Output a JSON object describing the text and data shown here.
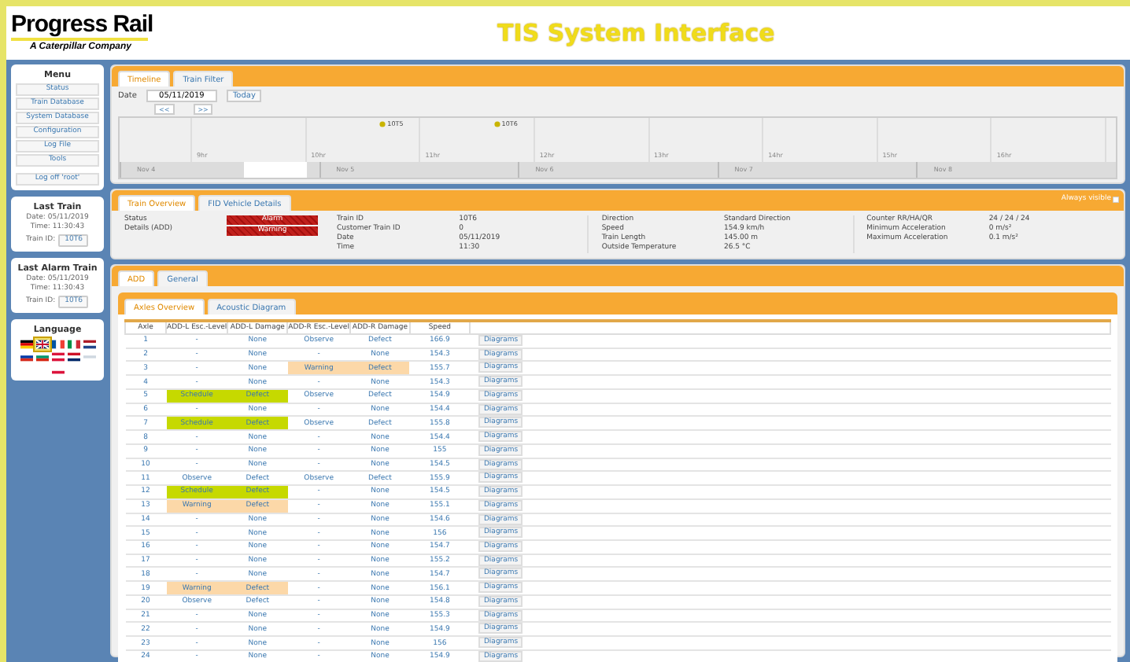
{
  "header": {
    "logo": "Progress Rail",
    "logo_sub": "A Caterpillar Company",
    "title": "TIS System Interface"
  },
  "sidebar": {
    "menu_title": "Menu",
    "menu": [
      "Status",
      "Train Database",
      "System Database",
      "Configuration",
      "Log File",
      "Tools"
    ],
    "logoff": "Log off 'root'",
    "last_train": {
      "title": "Last Train",
      "date": "Date: 05/11/2019",
      "time": "Time: 11:30:43",
      "id_label": "Train ID:",
      "id": "10T6"
    },
    "last_alarm_train": {
      "title": "Last Alarm Train",
      "date": "Date: 05/11/2019",
      "time": "Time: 11:30:43",
      "id_label": "Train ID:",
      "id": "10T6"
    },
    "language_title": "Language",
    "languages": [
      {
        "selected": false
      },
      {
        "selected": true
      },
      {
        "selected": false
      },
      {
        "selected": false
      },
      {
        "selected": false
      },
      {
        "selected": false
      },
      {
        "selected": false
      },
      {
        "selected": false
      },
      {
        "selected": false
      },
      {
        "selected": false
      },
      {
        "selected": false
      }
    ]
  },
  "timeline": {
    "tabs": [
      {
        "label": "Timeline",
        "selected": true
      },
      {
        "label": "Train Filter",
        "selected": false
      }
    ],
    "date_label": "Date",
    "date": "05/11/2019",
    "today": "Today",
    "prev": "<<",
    "next": ">>",
    "hours": [
      {
        "label": "9hr"
      },
      {
        "label": "10hr",
        "event": "10T5"
      },
      {
        "label": "11hr",
        "event": "10T6"
      },
      {
        "label": "12hr"
      },
      {
        "label": "13hr"
      },
      {
        "label": "14hr"
      },
      {
        "label": "15hr"
      },
      {
        "label": "16hr"
      }
    ],
    "days": [
      "Nov 4",
      "Nov 5",
      "Nov 6",
      "Nov 7",
      "Nov 8"
    ]
  },
  "overview": {
    "tabs": [
      {
        "label": "Train Overview",
        "selected": true
      },
      {
        "label": "FID Vehicle Details",
        "selected": false
      }
    ],
    "always_visible": "Always visible",
    "status_label": "Status",
    "status": "Alarm",
    "details_label": "Details (ADD)",
    "details": "Warning",
    "fields": [
      [
        {
          "label": "Train ID",
          "value": "10T6"
        },
        {
          "label": "Customer Train ID",
          "value": "0"
        },
        {
          "label": "Date",
          "value": "05/11/2019"
        },
        {
          "label": "Time",
          "value": "11:30"
        }
      ],
      [
        {
          "label": "Direction",
          "value": "Standard Direction"
        },
        {
          "label": "Speed",
          "value": "154.9 km/h"
        },
        {
          "label": "Train Length",
          "value": "145.00 m"
        },
        {
          "label": "Outside Temperature",
          "value": "26.5 °C"
        }
      ],
      [
        {
          "label": "Counter RR/HA/QR",
          "value": "24 / 24 / 24"
        },
        {
          "label": "Minimum Acceleration",
          "value": "0 m/s²"
        },
        {
          "label": "Maximum Acceleration",
          "value": "0.1 m/s²"
        }
      ]
    ]
  },
  "add": {
    "tabs": [
      {
        "label": "ADD",
        "selected": true
      },
      {
        "label": "General",
        "selected": false
      }
    ],
    "subtabs": [
      {
        "label": "Axles Overview",
        "selected": true
      },
      {
        "label": "Acoustic Diagram",
        "selected": false
      }
    ],
    "columns": [
      "Axle",
      "ADD-L Esc.-Level",
      "ADD-L Damage",
      "ADD-R Esc.-Level",
      "ADD-R Damage",
      "Speed"
    ],
    "rows": [
      {
        "cells": [
          {
            "text": "1"
          },
          {
            "text": "-"
          },
          {
            "text": "None"
          },
          {
            "text": "Observe"
          },
          {
            "text": "Defect"
          },
          {
            "text": "166.9"
          }
        ],
        "button": "Diagrams"
      },
      {
        "cells": [
          {
            "text": "2"
          },
          {
            "text": "-"
          },
          {
            "text": "None"
          },
          {
            "text": "-"
          },
          {
            "text": "None"
          },
          {
            "text": "154.3"
          }
        ],
        "button": "Diagrams"
      },
      {
        "cells": [
          {
            "text": "3"
          },
          {
            "text": "-"
          },
          {
            "text": "None"
          },
          {
            "text": "Warning",
            "color": "#fcd8a8"
          },
          {
            "text": "Defect",
            "color": "#fcd8a8"
          },
          {
            "text": "155.7"
          }
        ],
        "button": "Diagrams"
      },
      {
        "cells": [
          {
            "text": "4"
          },
          {
            "text": "-"
          },
          {
            "text": "None"
          },
          {
            "text": "-"
          },
          {
            "text": "None"
          },
          {
            "text": "154.3"
          }
        ],
        "button": "Diagrams"
      },
      {
        "cells": [
          {
            "text": "5"
          },
          {
            "text": "Schedule",
            "color": "#c6d900"
          },
          {
            "text": "Defect",
            "color": "#c6d900"
          },
          {
            "text": "Observe"
          },
          {
            "text": "Defect"
          },
          {
            "text": "154.9"
          }
        ],
        "button": "Diagrams"
      },
      {
        "cells": [
          {
            "text": "6"
          },
          {
            "text": "-"
          },
          {
            "text": "None"
          },
          {
            "text": "-"
          },
          {
            "text": "None"
          },
          {
            "text": "154.4"
          }
        ],
        "button": "Diagrams"
      },
      {
        "cells": [
          {
            "text": "7"
          },
          {
            "text": "Schedule",
            "color": "#c6d900"
          },
          {
            "text": "Defect",
            "color": "#c6d900"
          },
          {
            "text": "Observe"
          },
          {
            "text": "Defect"
          },
          {
            "text": "155.8"
          }
        ],
        "button": "Diagrams"
      },
      {
        "cells": [
          {
            "text": "8"
          },
          {
            "text": "-"
          },
          {
            "text": "None"
          },
          {
            "text": "-"
          },
          {
            "text": "None"
          },
          {
            "text": "154.4"
          }
        ],
        "button": "Diagrams"
      },
      {
        "cells": [
          {
            "text": "9"
          },
          {
            "text": "-"
          },
          {
            "text": "None"
          },
          {
            "text": "-"
          },
          {
            "text": "None"
          },
          {
            "text": "155"
          }
        ],
        "button": "Diagrams"
      },
      {
        "cells": [
          {
            "text": "10"
          },
          {
            "text": "-"
          },
          {
            "text": "None"
          },
          {
            "text": "-"
          },
          {
            "text": "None"
          },
          {
            "text": "154.5"
          }
        ],
        "button": "Diagrams"
      },
      {
        "cells": [
          {
            "text": "11"
          },
          {
            "text": "Observe"
          },
          {
            "text": "Defect"
          },
          {
            "text": "Observe"
          },
          {
            "text": "Defect"
          },
          {
            "text": "155.9"
          }
        ],
        "button": "Diagrams"
      },
      {
        "cells": [
          {
            "text": "12"
          },
          {
            "text": "Schedule",
            "color": "#c6d900"
          },
          {
            "text": "Defect",
            "color": "#c6d900"
          },
          {
            "text": "-"
          },
          {
            "text": "None"
          },
          {
            "text": "154.5"
          }
        ],
        "button": "Diagrams"
      },
      {
        "cells": [
          {
            "text": "13"
          },
          {
            "text": "Warning",
            "color": "#fcd8a8"
          },
          {
            "text": "Defect",
            "color": "#fcd8a8"
          },
          {
            "text": "-"
          },
          {
            "text": "None"
          },
          {
            "text": "155.1"
          }
        ],
        "button": "Diagrams"
      },
      {
        "cells": [
          {
            "text": "14"
          },
          {
            "text": "-"
          },
          {
            "text": "None"
          },
          {
            "text": "-"
          },
          {
            "text": "None"
          },
          {
            "text": "154.6"
          }
        ],
        "button": "Diagrams"
      },
      {
        "cells": [
          {
            "text": "15"
          },
          {
            "text": "-"
          },
          {
            "text": "None"
          },
          {
            "text": "-"
          },
          {
            "text": "None"
          },
          {
            "text": "156"
          }
        ],
        "button": "Diagrams"
      },
      {
        "cells": [
          {
            "text": "16"
          },
          {
            "text": "-"
          },
          {
            "text": "None"
          },
          {
            "text": "-"
          },
          {
            "text": "None"
          },
          {
            "text": "154.7"
          }
        ],
        "button": "Diagrams"
      },
      {
        "cells": [
          {
            "text": "17"
          },
          {
            "text": "-"
          },
          {
            "text": "None"
          },
          {
            "text": "-"
          },
          {
            "text": "None"
          },
          {
            "text": "155.2"
          }
        ],
        "button": "Diagrams"
      },
      {
        "cells": [
          {
            "text": "18"
          },
          {
            "text": "-"
          },
          {
            "text": "None"
          },
          {
            "text": "-"
          },
          {
            "text": "None"
          },
          {
            "text": "154.7"
          }
        ],
        "button": "Diagrams"
      },
      {
        "cells": [
          {
            "text": "19"
          },
          {
            "text": "Warning",
            "color": "#fcd8a8"
          },
          {
            "text": "Defect",
            "color": "#fcd8a8"
          },
          {
            "text": "-"
          },
          {
            "text": "None"
          },
          {
            "text": "156.1"
          }
        ],
        "button": "Diagrams"
      },
      {
        "cells": [
          {
            "text": "20"
          },
          {
            "text": "Observe"
          },
          {
            "text": "Defect"
          },
          {
            "text": "-"
          },
          {
            "text": "None"
          },
          {
            "text": "154.8"
          }
        ],
        "button": "Diagrams"
      },
      {
        "cells": [
          {
            "text": "21"
          },
          {
            "text": "-"
          },
          {
            "text": "None"
          },
          {
            "text": "-"
          },
          {
            "text": "None"
          },
          {
            "text": "155.3"
          }
        ],
        "button": "Diagrams"
      },
      {
        "cells": [
          {
            "text": "22"
          },
          {
            "text": "-"
          },
          {
            "text": "None"
          },
          {
            "text": "-"
          },
          {
            "text": "None"
          },
          {
            "text": "154.9"
          }
        ],
        "button": "Diagrams"
      },
      {
        "cells": [
          {
            "text": "23"
          },
          {
            "text": "-"
          },
          {
            "text": "None"
          },
          {
            "text": "-"
          },
          {
            "text": "None"
          },
          {
            "text": "156"
          }
        ],
        "button": "Diagrams"
      },
      {
        "cells": [
          {
            "text": "24"
          },
          {
            "text": "-"
          },
          {
            "text": "None"
          },
          {
            "text": "-"
          },
          {
            "text": "None"
          },
          {
            "text": "154.9"
          }
        ],
        "button": "Diagrams"
      }
    ]
  }
}
